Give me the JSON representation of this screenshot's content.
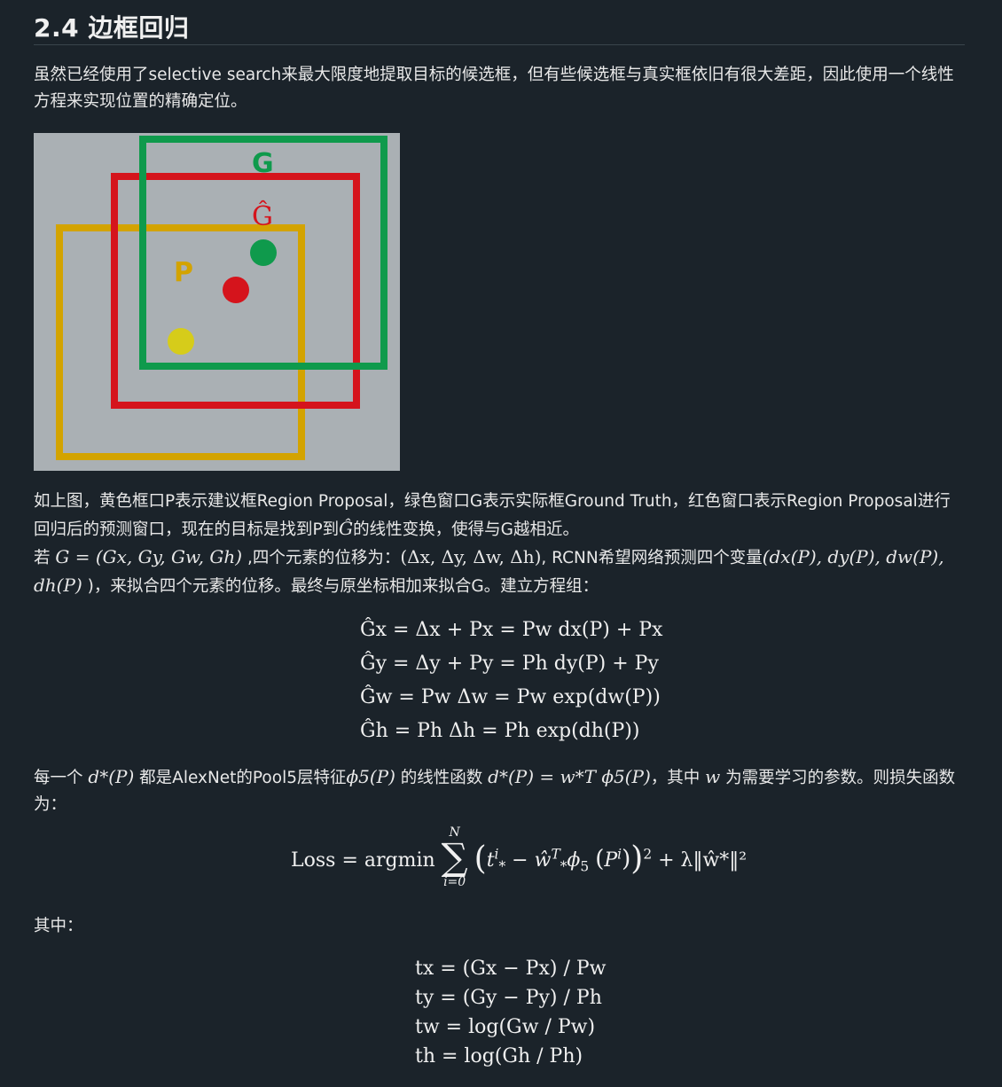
{
  "heading": "2.4 边框回归",
  "intro_line1": "虽然已经使用了selective search来最大限度地提取目标的候选框，但有些候选框与真实框依旧有很大差距，因此使用一个线性",
  "intro_line2": "方程来实现位置的精确定位。",
  "figure": {
    "label_g": "G",
    "label_ghat": "Ĝ",
    "label_p": "P",
    "colors": {
      "green": "#0f9a4c",
      "red": "#d5141c",
      "yellow": "#d3a300",
      "yellow_dot": "#d6cc1a",
      "background": "#aab0b4"
    }
  },
  "desc": {
    "line1": "如上图，黄色框口P表示建议框Region Proposal，绿色窗口G表示实际框Ground Truth，红色窗口表示Region Proposal进行",
    "line2a": "回归后的预测窗口，现在的目标是找到P到",
    "line2_sym": "Ĝ",
    "line2b": "的线性变换，使得与G越相近。",
    "line3_prefix": "若",
    "line3_eq": "G = (Gx, Gy, Gw, Gh)",
    "line3_mid": " ,四个元素的位移为：",
    "line3_deltas": "(Δx, Δy, Δw, Δh)",
    "line3_suffix": ", RCNN希望网络预测四个变量",
    "line3_vars": "(dx(P), dy(P), dw(P),",
    "line4_var": "dh(P)",
    "line4_text": " )，来拟合四个元素的位移。最终与原坐标相加来拟合G。建立方程组："
  },
  "equations": [
    "Ĝx = Δx + Px = Pw dx(P) + Px",
    "Ĝy = Δy + Py = Ph dy(P) + Py",
    "Ĝw = Pw Δw = Pw exp(dw(P))",
    "Ĝh = Ph Δh = Ph exp(dh(P))"
  ],
  "linear": {
    "t1": "每一个",
    "m1": "d*(P)",
    "t2": " 都是AlexNet的Pool5层特征",
    "m2": "ϕ5(P)",
    "t3": " 的线性函数 ",
    "m3": "d*(P) = w*T ϕ5(P)",
    "t4": "，其中 ",
    "m4": "w",
    "t5": " 为需要学习的参数。则损失函数",
    "line2": "为："
  },
  "loss": {
    "name": "Loss",
    "op": "= argmin",
    "sum_top": "N",
    "sum_bot": "i=0",
    "reg": "+ λ‖ŵ*‖²"
  },
  "where": "其中：",
  "targets": [
    "tx = (Gx − Px) / Pw",
    "ty = (Gy − Py) / Ph",
    "tw = log(Gw / Pw)",
    "th = log(Gh / Ph)"
  ]
}
